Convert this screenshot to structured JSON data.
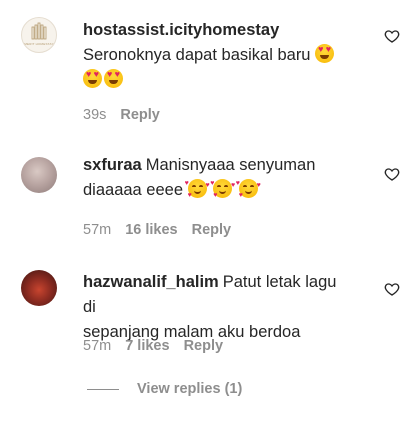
{
  "comments": [
    {
      "username": "hostassist.icityhomestay",
      "text": "Seronoknya dapat basikal baru",
      "emojis_inline": [
        "smiling-face-with-heart-eyes"
      ],
      "emojis_next_line": [
        "smiling-face-with-heart-eyes",
        "smiling-face-with-heart-eyes"
      ],
      "avatar_logo_text": "MERIT HOMESTAY",
      "time": "39s",
      "likes": "",
      "reply_label": "Reply",
      "like_icon": "heart-outline-icon"
    },
    {
      "username": "sxfuraa",
      "text_line1": "Manisnyaaa senyuman",
      "text_line2": "diaaaaa eeee",
      "emojis": [
        "smiling-face-with-hearts",
        "smiling-face-with-hearts",
        "smiling-face-with-hearts"
      ],
      "time": "57m",
      "likes": "16 likes",
      "reply_label": "Reply",
      "like_icon": "heart-outline-icon"
    },
    {
      "username": "hazwanalif_halim",
      "text_line1": "Patut letak lagu di",
      "text_line2": "sepanjang malam aku berdoa",
      "time": "57m",
      "likes": "7 likes",
      "reply_label": "Reply",
      "like_icon": "heart-outline-icon"
    }
  ],
  "view_replies": {
    "label": "View replies (1)"
  },
  "colors": {
    "text": "#262626",
    "secondary": "#8e8e8e",
    "background": "#ffffff"
  }
}
